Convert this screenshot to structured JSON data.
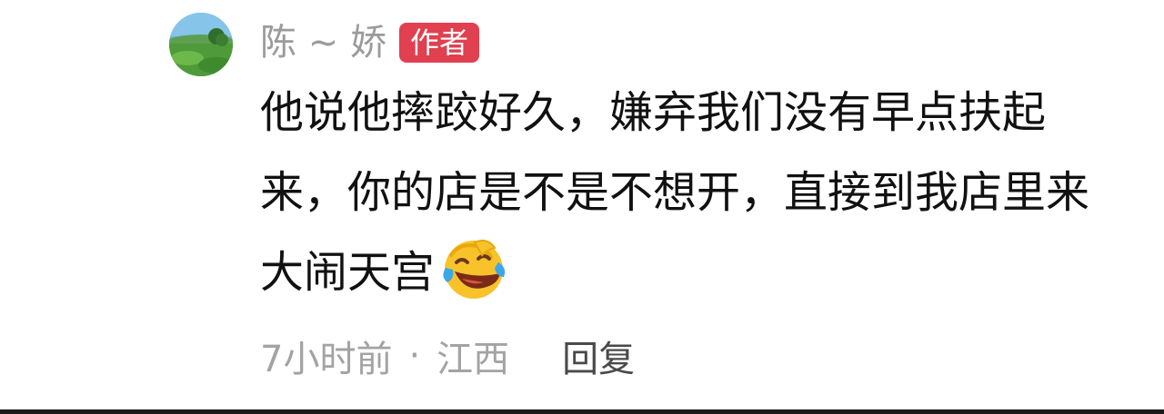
{
  "user": {
    "name": "陈 ~ 娇",
    "badge": "作者"
  },
  "comment": {
    "lines": [
      "他说他摔跤好久，嫌弃我们没有早点扶起",
      "来，你的店是不是不想开，直接到我店里来",
      "大闹天宫"
    ],
    "emoji": "laughing-crying-emoji"
  },
  "meta": {
    "time": "7小时前",
    "separator": "·",
    "location": "江西",
    "reply": "回复"
  },
  "colors": {
    "badge": "#e0404f",
    "username": "#9b9b9b",
    "meta": "#a3a3a3",
    "text": "#111111"
  }
}
